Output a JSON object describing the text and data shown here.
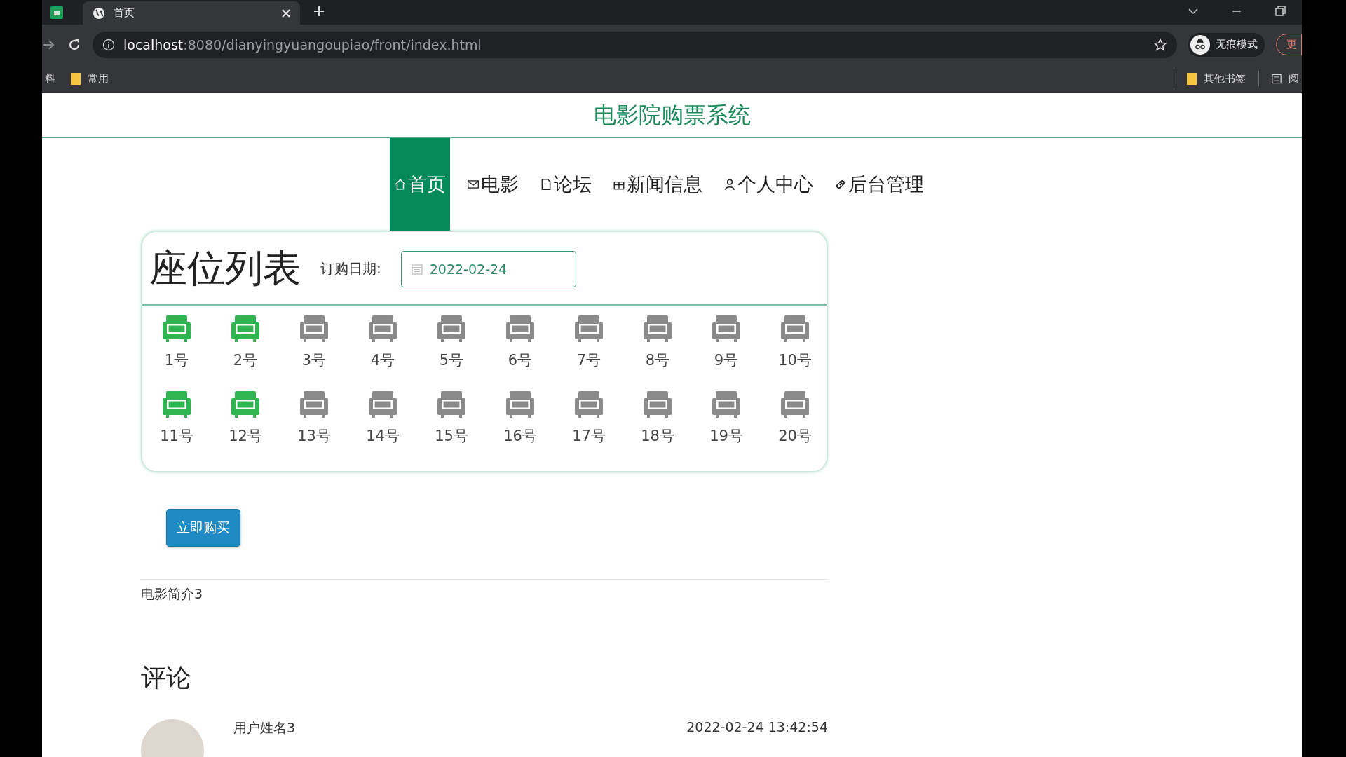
{
  "browser": {
    "tab_title": "首页",
    "url_host": "localhost",
    "url_path": ":8080/dianyingyuangoupiao/front/index.html",
    "profile_label": "无痕模式",
    "update_label": "更",
    "bookmarks_left": [
      {
        "label": "料",
        "kind": "text"
      },
      {
        "label": "常用",
        "kind": "folder"
      }
    ],
    "bookmarks_right": [
      {
        "label": "其他书签",
        "kind": "folder"
      },
      {
        "label": "阅",
        "kind": "reader"
      }
    ]
  },
  "site_title": "电影院购票系统",
  "nav": [
    {
      "label": "首页",
      "kind": "home",
      "selected": true
    },
    {
      "label": "电影",
      "kind": "mail",
      "selected": false
    },
    {
      "label": "论坛",
      "kind": "doc",
      "selected": false
    },
    {
      "label": "新闻信息",
      "kind": "gift",
      "selected": false
    },
    {
      "label": "个人中心",
      "kind": "user",
      "selected": false
    },
    {
      "label": "后台管理",
      "kind": "link",
      "selected": false
    }
  ],
  "seat_panel": {
    "title": "座位列表",
    "date_label": "订购日期:",
    "date_value": "2022-02-24",
    "seats": [
      {
        "label": "1号",
        "selected": true
      },
      {
        "label": "2号",
        "selected": true
      },
      {
        "label": "3号",
        "selected": false
      },
      {
        "label": "4号",
        "selected": false
      },
      {
        "label": "5号",
        "selected": false
      },
      {
        "label": "6号",
        "selected": false
      },
      {
        "label": "7号",
        "selected": false
      },
      {
        "label": "8号",
        "selected": false
      },
      {
        "label": "9号",
        "selected": false
      },
      {
        "label": "10号",
        "selected": false
      },
      {
        "label": "11号",
        "selected": true
      },
      {
        "label": "12号",
        "selected": true
      },
      {
        "label": "13号",
        "selected": false
      },
      {
        "label": "14号",
        "selected": false
      },
      {
        "label": "15号",
        "selected": false
      },
      {
        "label": "16号",
        "selected": false
      },
      {
        "label": "17号",
        "selected": false
      },
      {
        "label": "18号",
        "selected": false
      },
      {
        "label": "19号",
        "selected": false
      },
      {
        "label": "20号",
        "selected": false
      }
    ]
  },
  "buy_button": "立即购买",
  "description": "电影简介3",
  "comments_title": "评论",
  "comments": [
    {
      "user": "用户姓名3",
      "time": "2022-02-24 13:42:54"
    }
  ]
}
